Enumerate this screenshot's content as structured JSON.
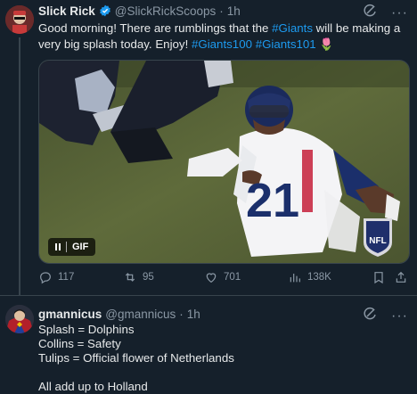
{
  "post1": {
    "author": {
      "name": "Slick Rick",
      "handle": "@SlickRickScoops",
      "time": "1h"
    },
    "text_pre": "Good morning! There are rumblings that the ",
    "hashtag_giants": "#Giants",
    "text_mid": " will be making a very big splash today. Enjoy! ",
    "hashtag_g100": "#Giants100",
    "hashtag_g101": "#Giants101",
    "tulip_emoji": "🌷",
    "media": {
      "badge_label": "GIF",
      "jersey_number": "21",
      "logo_text": "NFL"
    },
    "stats": {
      "replies": "117",
      "reposts": "95",
      "likes": "701",
      "views": "138K"
    }
  },
  "post2": {
    "author": {
      "name": "gmannicus",
      "handle": "@gmannicus",
      "time": "1h"
    },
    "lines": [
      "Splash = Dolphins",
      "Collins = Safety",
      "Tulips = Official flower of Netherlands",
      "",
      "All add up to Holland"
    ]
  },
  "icons": {
    "verified": "verified-badge-icon",
    "grok": "grok-icon",
    "more": "more-icon",
    "reply": "reply-icon",
    "repost": "repost-icon",
    "like": "like-icon",
    "views": "views-icon",
    "bookmark": "bookmark-icon",
    "share": "share-icon"
  },
  "colors": {
    "background": "#15202b",
    "accent": "#1d9bf0",
    "muted": "#8b98a5",
    "text": "#e7e9ea"
  }
}
